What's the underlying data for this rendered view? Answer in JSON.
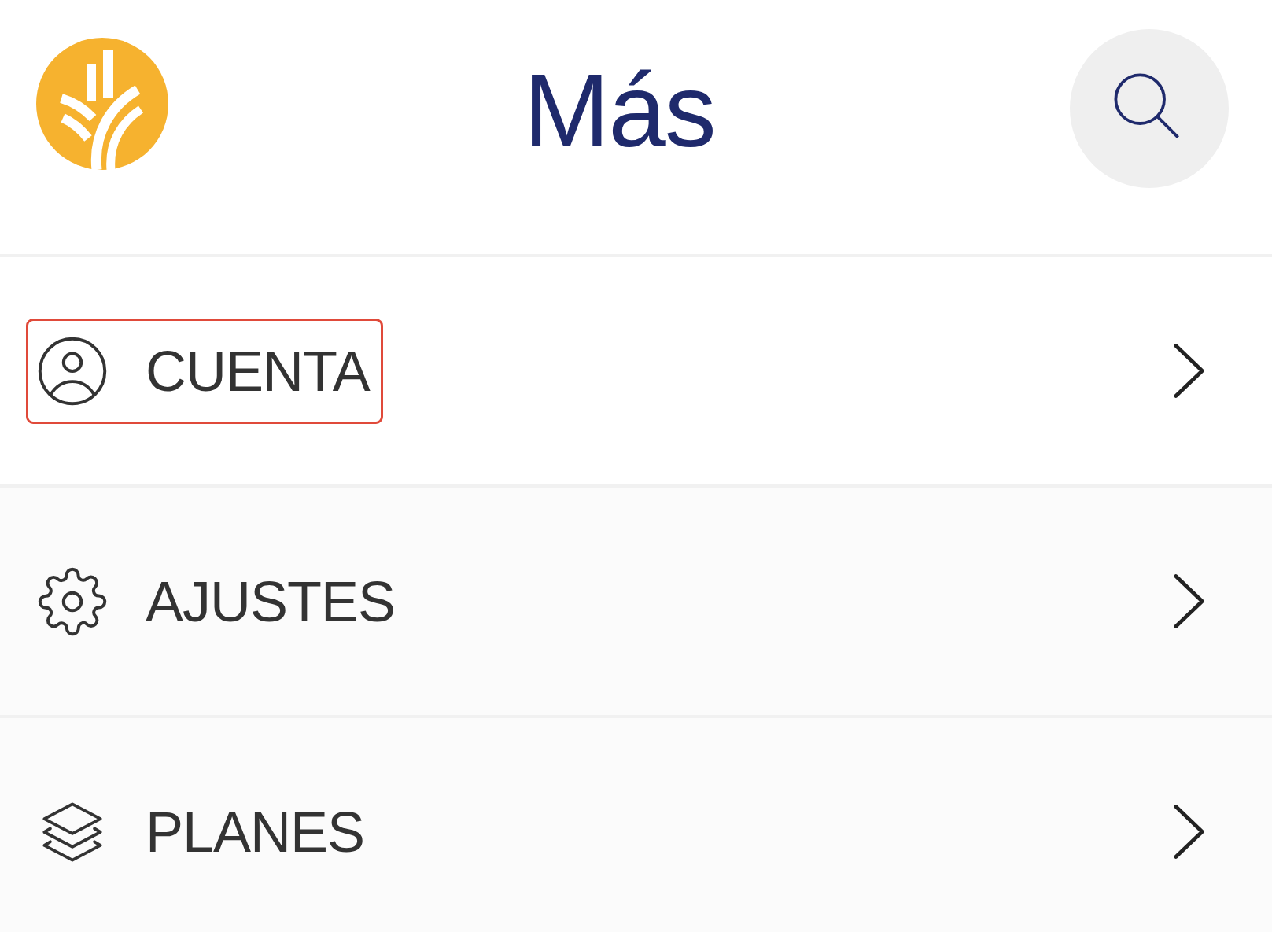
{
  "header": {
    "title": "Más"
  },
  "menu": {
    "items": [
      {
        "label": "CUENTA",
        "highlighted": true
      },
      {
        "label": "AJUSTES",
        "highlighted": false
      },
      {
        "label": "PLANES",
        "highlighted": false
      }
    ]
  }
}
